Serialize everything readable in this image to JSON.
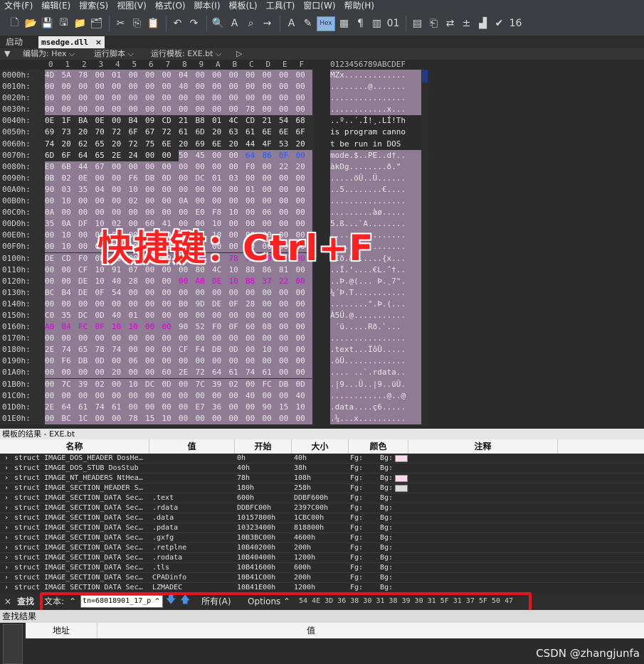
{
  "menu": [
    "文件(F)",
    "编辑(E)",
    "搜索(S)",
    "视图(V)",
    "格式(O)",
    "脚本(I)",
    "模板(L)",
    "工具(T)",
    "窗口(W)",
    "帮助(H)"
  ],
  "toolbar": {
    "icons": [
      "new-file-icon",
      "open-folder-icon",
      "save-icon",
      "save-all-icon",
      "open-recent-icon",
      "open-project-icon",
      "cut-icon",
      "copy-icon",
      "paste-icon",
      "undo-icon",
      "redo-icon",
      "find-icon",
      "replace-icon",
      "find-in-files-icon",
      "goto-icon",
      "font-icon",
      "highlight-icon"
    ],
    "hex_label": "Hex",
    "right_icons": [
      "show-hex-icon",
      "pilcrow-icon",
      "columns-icon",
      "binary-icon",
      "calculator-icon",
      "clipboard-icon",
      "compare-icon",
      "math-icon",
      "histogram-icon",
      "checksum-icon",
      "base-convert-icon"
    ]
  },
  "tabs": {
    "start": "启动",
    "file": "msedge.dll",
    "close": "×"
  },
  "editbar": {
    "edit_as": "编辑为: Hex ⌵",
    "run_script": "运行脚本 ⌵",
    "run_template": "运行模板: EXE.bt ⌵",
    "arrow": "▷"
  },
  "columns": [
    "0",
    "1",
    "2",
    "3",
    "4",
    "5",
    "6",
    "7",
    "8",
    "9",
    "A",
    "B",
    "C",
    "D",
    "E",
    "F"
  ],
  "ascii_header": "0123456789ABCDEF",
  "hex_rows": [
    {
      "offset": "0000h:",
      "bytes": "4D 5A 78 00 01 00 00 00 04 00 00 00 00 00 00 00",
      "ascii": "MZx............."
    },
    {
      "offset": "0010h:",
      "bytes": "00 00 00 00 00 00 00 00 40 00 00 00 00 00 00 00",
      "ascii": "........@......."
    },
    {
      "offset": "0020h:",
      "bytes": "00 00 00 00 00 00 00 00 00 00 00 00 00 00 00 00",
      "ascii": "................"
    },
    {
      "offset": "0030h:",
      "bytes": "00 00 00 00 00 00 00 00 00 00 00 00 78 00 00 00",
      "ascii": "............x..."
    },
    {
      "offset": "0040h:",
      "bytes": "0E 1F BA 0E 00 B4 09 CD 21 B8 01 4C CD 21 54 68",
      "ascii": "..º..´.Í!¸.LÍ!Th"
    },
    {
      "offset": "0050h:",
      "bytes": "69 73 20 70 72 6F 67 72 61 6D 20 63 61 6E 6E 6F",
      "ascii": "is program canno"
    },
    {
      "offset": "0060h:",
      "bytes": "74 20 62 65 20 72 75 6E 20 69 6E 20 44 4F 53 20",
      "ascii": "t be run in DOS "
    },
    {
      "offset": "0070h:",
      "bytes": "6D 6F 64 65 2E 24 00 00 50 45 00 00 64 86 0F 00",
      "ascii": "mode.$..PE..d†.."
    },
    {
      "offset": "0080h:",
      "bytes": "E0 6B 44 67 00 00 00 00 00 00 00 00 F0 00 22 20",
      "ascii": "àkDg........ð.\" "
    },
    {
      "offset": "0090h:",
      "bytes": "0B 02 0E 00 00 F6 DB 0D 00 DC 01 03 00 00 00 00",
      "ascii": ".....öÛ..Ü......"
    },
    {
      "offset": "00A0h:",
      "bytes": "90 03 35 04 00 10 00 00 00 00 00 80 01 00 00 00",
      "ascii": "..5........€...."
    },
    {
      "offset": "00B0h:",
      "bytes": "00 10 00 00 00 02 00 00 0A 00 00 00 00 00 00 00",
      "ascii": "................"
    },
    {
      "offset": "00C0h:",
      "bytes": "0A 00 00 00 00 00 00 00 00 E0 F8 10 00 06 00 00",
      "ascii": ".........àø....."
    },
    {
      "offset": "00D0h:",
      "bytes": "35 0A DF 10 02 00 60 41 00 00 10 00 00 00 00 00",
      "ascii": "5.ß...`A........"
    },
    {
      "offset": "00E0h:",
      "bytes": "00 10 00 00 00 00 00 00 00 00 10 00 00 00 00 00",
      "ascii": "................"
    },
    {
      "offset": "00F0h:",
      "bytes": "00 10 00 00 00 00 00 00 00 00 00 00 10 00 00 00",
      "ascii": "................"
    },
    {
      "offset": "0100h:",
      "bytes": "DE CD F0 0F 26 00 00 00 14 0F 0F 7B 78 00 00 00",
      "ascii": "ÞÍð.&......{x..."
    },
    {
      "offset": "0110h:",
      "bytes": "00 00 CF 10 91 07 00 00 00 80 4C 10 88 86 81 00",
      "ascii": "..Ï.‘....€L.ˆ†.."
    },
    {
      "offset": "0120h:",
      "bytes": "00 00 DE 10 40 28 00 00 00 A0 DE 10 B8 37 22 00",
      "ascii": "..Þ.@(... Þ.¸7\"."
    },
    {
      "offset": "0130h:",
      "bytes": "BC B4 DE 0F 54 00 00 00 00 00 00 00 00 00 00 00",
      "ascii": "¼´Þ.T..........."
    },
    {
      "offset": "0140h:",
      "bytes": "00 00 00 00 00 00 00 00 B0 9D DE 0F 28 00 00 00",
      "ascii": "........°.Þ.(..."
    },
    {
      "offset": "0150h:",
      "bytes": "C0 35 DC 0D 40 01 00 00 00 00 00 00 00 00 00 00",
      "ascii": "À5Ü.@..........."
    },
    {
      "offset": "0160h:",
      "bytes": "A0 B4 FC 0F 10 10 00 00 90 52 F0 0F 60 08 00 00",
      "ascii": " ´ü.....Rð.`..."
    },
    {
      "offset": "0170h:",
      "bytes": "00 00 00 00 00 00 00 00 00 00 00 00 00 00 00 00",
      "ascii": "................"
    },
    {
      "offset": "0180h:",
      "bytes": "2E 74 65 78 74 00 00 00 CF F4 DB 0D 00 10 00 00",
      "ascii": ".text...ÏôÛ....."
    },
    {
      "offset": "0190h:",
      "bytes": "00 F6 DB 0D 00 06 00 00 00 00 00 00 00 00 00 00",
      "ascii": ".öÛ............."
    },
    {
      "offset": "01A0h:",
      "bytes": "00 00 00 00 20 00 00 60 2E 72 64 61 74 61 00 00",
      "ascii": ".... ..`.rdata.."
    },
    {
      "offset": "01B0h:",
      "bytes": "00 7C 39 02 00 10 DC 0D 00 7C 39 02 00 FC DB 0D",
      "ascii": ".|9...Ü..|9..üÛ."
    },
    {
      "offset": "01C0h:",
      "bytes": "00 00 00 00 00 00 00 00 00 00 00 00 40 00 00 40",
      "ascii": "............@..@"
    },
    {
      "offset": "01D0h:",
      "bytes": "2E 64 61 74 61 00 00 00 00 E7 36 00 00 90 15 10",
      "ascii": ".data....ç6....."
    },
    {
      "offset": "01E0h:",
      "bytes": "00 BC 1C 00 00 78 15 10 00 00 00 00 00 00 00 00",
      "ascii": ".¼...x.........."
    }
  ],
  "overlay_text": "快捷键：Ctrl+F",
  "template_results": {
    "title": "模板的结果 - EXE.bt",
    "headers": [
      "名称",
      "值",
      "开始",
      "大小",
      "颜色",
      "注释"
    ],
    "rows": [
      {
        "name": "struct IMAGE_DOS_HEADER DosHe…",
        "value": "",
        "start": "0h",
        "size": "40h",
        "fg": "Fg:",
        "bg": "Bg:"
      },
      {
        "name": "struct IMAGE_DOS_STUB DosStub",
        "value": "",
        "start": "40h",
        "size": "38h",
        "fg": "Fg:",
        "bg": "Bg:"
      },
      {
        "name": "struct IMAGE_NT_HEADERS NtHea…",
        "value": "",
        "start": "78h",
        "size": "108h",
        "fg": "Fg:",
        "bg": "Bg:"
      },
      {
        "name": "struct IMAGE_SECTION_HEADER S…",
        "value": "",
        "start": "180h",
        "size": "258h",
        "fg": "Fg:",
        "bg": "Bg:"
      },
      {
        "name": "struct IMAGE_SECTION_DATA Sec…",
        "value": ".text",
        "start": "600h",
        "size": "DDBF600h",
        "fg": "Fg:",
        "bg": "Bg:"
      },
      {
        "name": "struct IMAGE_SECTION_DATA Sec…",
        "value": ".rdata",
        "start": "DDBFC00h",
        "size": "2397C00h",
        "fg": "Fg:",
        "bg": "Bg:"
      },
      {
        "name": "struct IMAGE_SECTION_DATA Sec…",
        "value": ".data",
        "start": "10157800h",
        "size": "1CBC00h",
        "fg": "Fg:",
        "bg": "Bg:"
      },
      {
        "name": "struct IMAGE_SECTION_DATA Sec…",
        "value": ".pdata",
        "start": "10323400h",
        "size": "818800h",
        "fg": "Fg:",
        "bg": "Bg:"
      },
      {
        "name": "struct IMAGE_SECTION_DATA Sec…",
        "value": ".gxfg",
        "start": "10B3BC00h",
        "size": "4600h",
        "fg": "Fg:",
        "bg": "Bg:"
      },
      {
        "name": "struct IMAGE_SECTION_DATA Sec…",
        "value": ".retplne",
        "start": "10B40200h",
        "size": "200h",
        "fg": "Fg:",
        "bg": "Bg:"
      },
      {
        "name": "struct IMAGE_SECTION_DATA Sec…",
        "value": ".rodata",
        "start": "10B40400h",
        "size": "1200h",
        "fg": "Fg:",
        "bg": "Bg:"
      },
      {
        "name": "struct IMAGE_SECTION_DATA Sec…",
        "value": ".tls",
        "start": "10B41600h",
        "size": "600h",
        "fg": "Fg:",
        "bg": "Bg:"
      },
      {
        "name": "struct IMAGE_SECTION_DATA Sec…",
        "value": "CPADinfo",
        "start": "10B41C00h",
        "size": "200h",
        "fg": "Fg:",
        "bg": "Bg:"
      },
      {
        "name": "struct IMAGE_SECTION_DATA Sec…",
        "value": "LZMADEC",
        "start": "10B41E00h",
        "size": "1200h",
        "fg": "Fg:",
        "bg": "Bg:"
      }
    ]
  },
  "find": {
    "close": "×",
    "label": "查找",
    "mode": "文本:",
    "input_value": "tn=68018901_17_p",
    "all": "所有(A)",
    "options": "Options",
    "hex_display": "54 4E 3D 36 38 30 31 38 39 30 31 5F 31 37 5F 50 47"
  },
  "find_results": {
    "title": "查找结果",
    "headers": [
      "地址",
      "值"
    ]
  },
  "watermark": "CSDN @zhangjunfa",
  "colors": {
    "selection_bg": "#8f7b94",
    "magenta": "#e000e0",
    "accent_red": "#e8141c"
  }
}
